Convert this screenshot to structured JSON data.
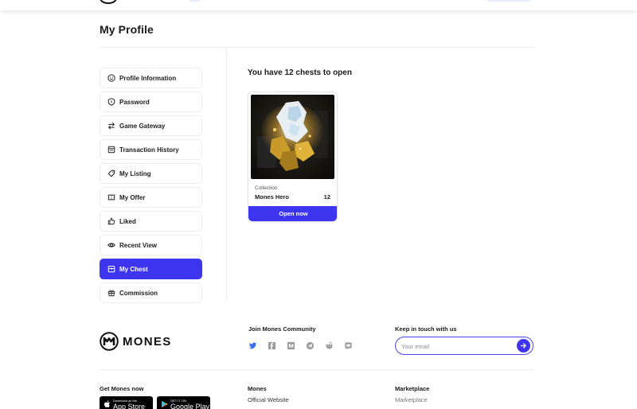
{
  "page": {
    "title": "My Profile"
  },
  "sidebar": {
    "items": [
      {
        "label": "Profile Information",
        "icon": "smile-icon",
        "active": false
      },
      {
        "label": "Password",
        "icon": "shield-icon",
        "active": false
      },
      {
        "label": "Game Gateway",
        "icon": "swap-arrows-icon",
        "active": false
      },
      {
        "label": "Transaction History",
        "icon": "receipt-icon",
        "active": false
      },
      {
        "label": "My Listing",
        "icon": "tag-icon",
        "active": false
      },
      {
        "label": "My Offer",
        "icon": "ticket-icon",
        "active": false
      },
      {
        "label": "Liked",
        "icon": "thumbs-up-icon",
        "active": false
      },
      {
        "label": "Recent View",
        "icon": "eye-icon",
        "active": false
      },
      {
        "label": "My Chest",
        "icon": "chest-icon",
        "active": true
      },
      {
        "label": "Commission",
        "icon": "gift-icon",
        "active": false
      }
    ]
  },
  "main": {
    "heading": "You have 12 chests to open",
    "chest": {
      "collection_label": "Collection",
      "name": "Mones Hero",
      "count": "12",
      "button_label": "Open now"
    }
  },
  "footer": {
    "brand": "MONES",
    "community_title": "Join Mones Community",
    "socials": [
      "twitter-icon",
      "facebook-icon",
      "medium-icon",
      "telegram-icon",
      "reddit-icon",
      "discord-icon"
    ],
    "newsletter": {
      "title": "Keep in touch with us",
      "placeholder": "Your email"
    },
    "get_app_title": "Get Mones now",
    "app_store": {
      "small": "Download on the",
      "big": "App Store"
    },
    "google_play": {
      "small": "GET IT ON",
      "big": "Google Play"
    },
    "columns": [
      {
        "title": "Mones",
        "link": "Official Website"
      },
      {
        "title": "Marketplace",
        "link": "Marketplace"
      }
    ]
  },
  "colors": {
    "accent": "#3d35f0",
    "border": "#ececec",
    "text": "#1a1a1a"
  }
}
